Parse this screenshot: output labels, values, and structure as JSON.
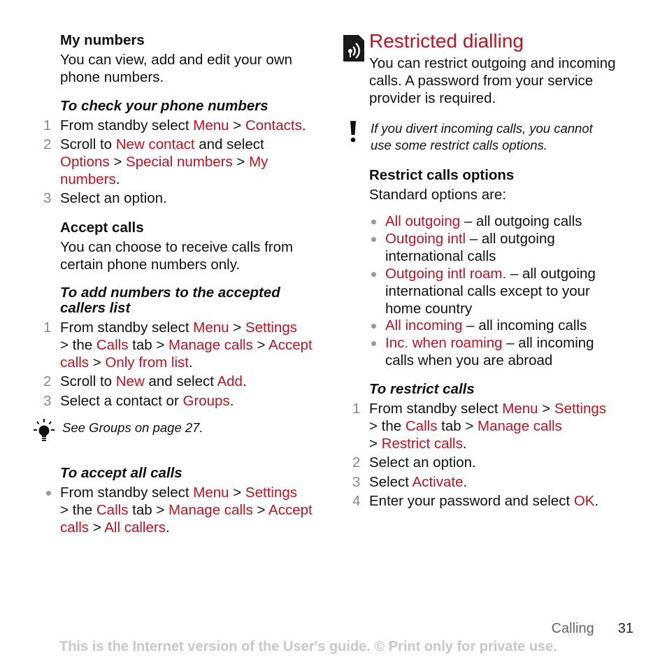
{
  "left": {
    "my_numbers": {
      "heading": "My numbers",
      "body": [
        "You can view, add and edit your own",
        "phone numbers."
      ]
    },
    "check_numbers": {
      "heading": "To check your phone numbers",
      "steps": [
        {
          "n": "1",
          "parts": [
            "From standby select ",
            "Menu",
            " > ",
            "Contacts",
            "."
          ]
        },
        {
          "n": "2",
          "l1": [
            "Scroll to ",
            "New contact",
            " and select"
          ],
          "l2": [
            "Options",
            " > ",
            "Special numbers",
            " > ",
            "My"
          ],
          "l3": [
            "numbers",
            "."
          ]
        },
        {
          "n": "3",
          "text": "Select an option."
        }
      ]
    },
    "accept_calls": {
      "heading": "Accept calls",
      "body": [
        "You can choose to receive calls from",
        "certain phone numbers only."
      ]
    },
    "add_numbers": {
      "heading_l1": "To add numbers to the accepted",
      "heading_l2": "callers list",
      "steps": [
        {
          "n": "1",
          "l1": [
            "From standby select ",
            "Menu",
            " > ",
            "Settings"
          ],
          "l2": [
            "> the ",
            "Calls",
            " tab > ",
            "Manage calls",
            " > ",
            "Accept"
          ],
          "l3": [
            "calls",
            " > ",
            "Only from list",
            "."
          ]
        },
        {
          "n": "2",
          "parts": [
            "Scroll to ",
            "New",
            " and select ",
            "Add",
            "."
          ]
        },
        {
          "n": "3",
          "parts": [
            "Select a contact or ",
            "Groups",
            "."
          ]
        }
      ]
    },
    "tip": {
      "icon": "lightbulb-icon",
      "text": "See Groups on page 27."
    },
    "accept_all": {
      "heading": "To accept all calls",
      "l1": [
        "From standby select ",
        "Menu",
        " > ",
        "Settings"
      ],
      "l2": [
        "> the ",
        "Calls",
        " tab > ",
        "Manage calls",
        " > ",
        "Accept"
      ],
      "l3": [
        "calls",
        " > ",
        "All callers",
        "."
      ]
    }
  },
  "right": {
    "section": {
      "icon": "network-service-icon",
      "title": "Restricted dialling",
      "body": [
        "You can restrict outgoing and incoming",
        "calls. A password from your service",
        "provider is required."
      ]
    },
    "warning": {
      "icon": "exclamation-icon",
      "lines": [
        "If you divert incoming calls, you cannot",
        "use some restrict calls options."
      ]
    },
    "options": {
      "heading": "Restrict calls options",
      "intro": "Standard options are:",
      "items": [
        {
          "term": "All outgoing",
          "desc": [
            " – all outgoing calls"
          ]
        },
        {
          "term": "Outgoing intl",
          "desc": [
            " – all outgoing",
            "international calls"
          ]
        },
        {
          "term": "Outgoing intl roam.",
          "desc": [
            " – all outgoing",
            "international calls except to your",
            "home country"
          ]
        },
        {
          "term": "All incoming",
          "desc": [
            " – all incoming calls"
          ]
        },
        {
          "term": "Inc. when roaming",
          "desc": [
            " – all incoming",
            "calls when you are abroad"
          ]
        }
      ]
    },
    "restrict": {
      "heading": "To restrict calls",
      "steps": [
        {
          "n": "1",
          "l1": [
            "From standby select ",
            "Menu",
            " > ",
            "Settings"
          ],
          "l2": [
            "> the ",
            "Calls",
            " tab > ",
            "Manage calls"
          ],
          "l3": [
            "> ",
            "Restrict calls",
            "."
          ]
        },
        {
          "n": "2",
          "text": "Select an option."
        },
        {
          "n": "3",
          "parts": [
            "Select ",
            "Activate",
            "."
          ]
        },
        {
          "n": "4",
          "parts": [
            "Enter your password and select ",
            "OK",
            "."
          ]
        }
      ]
    }
  },
  "footer": {
    "chapter": "Calling",
    "page": "31",
    "watermark": "This is the Internet version of the User's guide. © Print only for private use."
  },
  "colors": {
    "accent": "#c1121f",
    "text": "#111111",
    "muted": "#888888",
    "watermark": "#c8c8c8"
  }
}
